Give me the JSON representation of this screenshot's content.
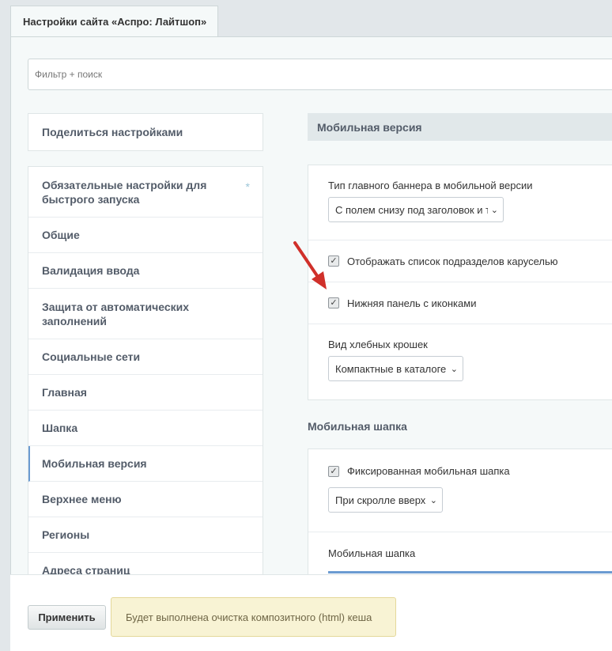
{
  "tab": {
    "title": "Настройки сайта «Аспро: Лайтшоп»"
  },
  "filter": {
    "placeholder": "Фильтр + поиск"
  },
  "share": {
    "label": "Поделиться настройками"
  },
  "nav": {
    "items": [
      {
        "label": "Обязательные настройки для быстрого запуска",
        "star": "*"
      },
      {
        "label": "Общие"
      },
      {
        "label": "Валидация ввода"
      },
      {
        "label": "Защита от автоматических заполнений"
      },
      {
        "label": "Социальные сети"
      },
      {
        "label": "Главная"
      },
      {
        "label": "Шапка"
      },
      {
        "label": "Мобильная версия"
      },
      {
        "label": "Верхнее меню"
      },
      {
        "label": "Регионы"
      },
      {
        "label": "Адреса страниц"
      }
    ]
  },
  "mobile": {
    "header": "Мобильная версия",
    "banner_label": "Тип главного баннера в мобильной версии",
    "banner_value": "С полем снизу под заголовок и т",
    "carousel_label": "Отображать список подразделов каруселью",
    "bottom_panel_label": "Нижняя панель с иконками",
    "breadcrumbs_label": "Вид хлебных крошек",
    "breadcrumbs_value": "Компактные в каталоге"
  },
  "mobile_header": {
    "title": "Мобильная шапка",
    "fixed_label": "Фиксированная мобильная шапка",
    "fixed_value": "При скролле вверх",
    "header_label": "Мобильная шапка"
  },
  "footer": {
    "apply_label": "Применить",
    "notice": "Будет выполнена очистка композитного (html) кеша"
  },
  "glyphs": {
    "check": "✓",
    "chevron": "⌄"
  },
  "colors": {
    "arrow": "#d0302a",
    "active_border": "#6b9bd1"
  }
}
